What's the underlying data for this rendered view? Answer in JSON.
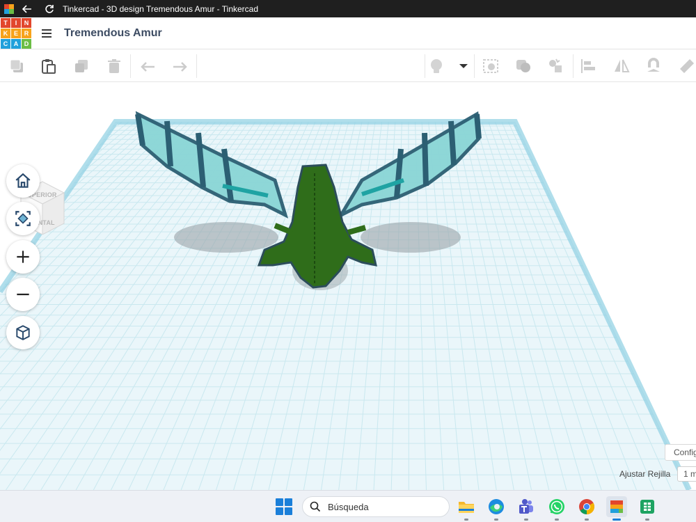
{
  "browser": {
    "window_title": "Tinkercad - 3D design Tremendous Amur - Tinkercad",
    "back_icon": "arrow-left-icon",
    "reload_icon": "reload-icon"
  },
  "app": {
    "logo_letters": [
      "TIN",
      "KER",
      "CAD"
    ],
    "logo_colors": [
      "#e2462c",
      "#f7a21b",
      "#21a0db",
      "#6bbd45"
    ],
    "design_name": "Tremendous Amur"
  },
  "toolbar": {
    "left_tools": [
      "copy-icon",
      "paste-icon",
      "duplicate-icon",
      "delete-icon",
      "undo-icon",
      "redo-icon"
    ],
    "right_tools": [
      "note-bulb-icon",
      "dropdown-caret-icon",
      "show-all-icon",
      "hole-solid-icon",
      "group-icon",
      "align-icon",
      "mirror-icon",
      "workplane-magnet-icon",
      "ruler-icon"
    ]
  },
  "viewcube": {
    "top_label": "SUPERIOR",
    "front_label": "FRONTAL"
  },
  "view_controls": [
    "home-icon",
    "fit-view-icon",
    "zoom-in-icon",
    "zoom-out-icon",
    "perspective-icon"
  ],
  "workplane": {
    "grid_color": "#c9e8ef",
    "plane_fill": "#e9f6fa",
    "edge_color": "#8fd0e3",
    "model_body_color": "#2f6d1a",
    "model_wing_color": "#7fd3d3"
  },
  "bottom_panel": {
    "config_label": "Config",
    "grid_label": "Ajustar Rejilla",
    "grid_value": "1 m"
  },
  "taskbar": {
    "search_placeholder": "Búsqueda",
    "apps": [
      "file-explorer-icon",
      "edge-icon",
      "teams-icon",
      "whatsapp-icon",
      "chrome-icon",
      "tinkercad-icon",
      "sheets-icon"
    ]
  }
}
